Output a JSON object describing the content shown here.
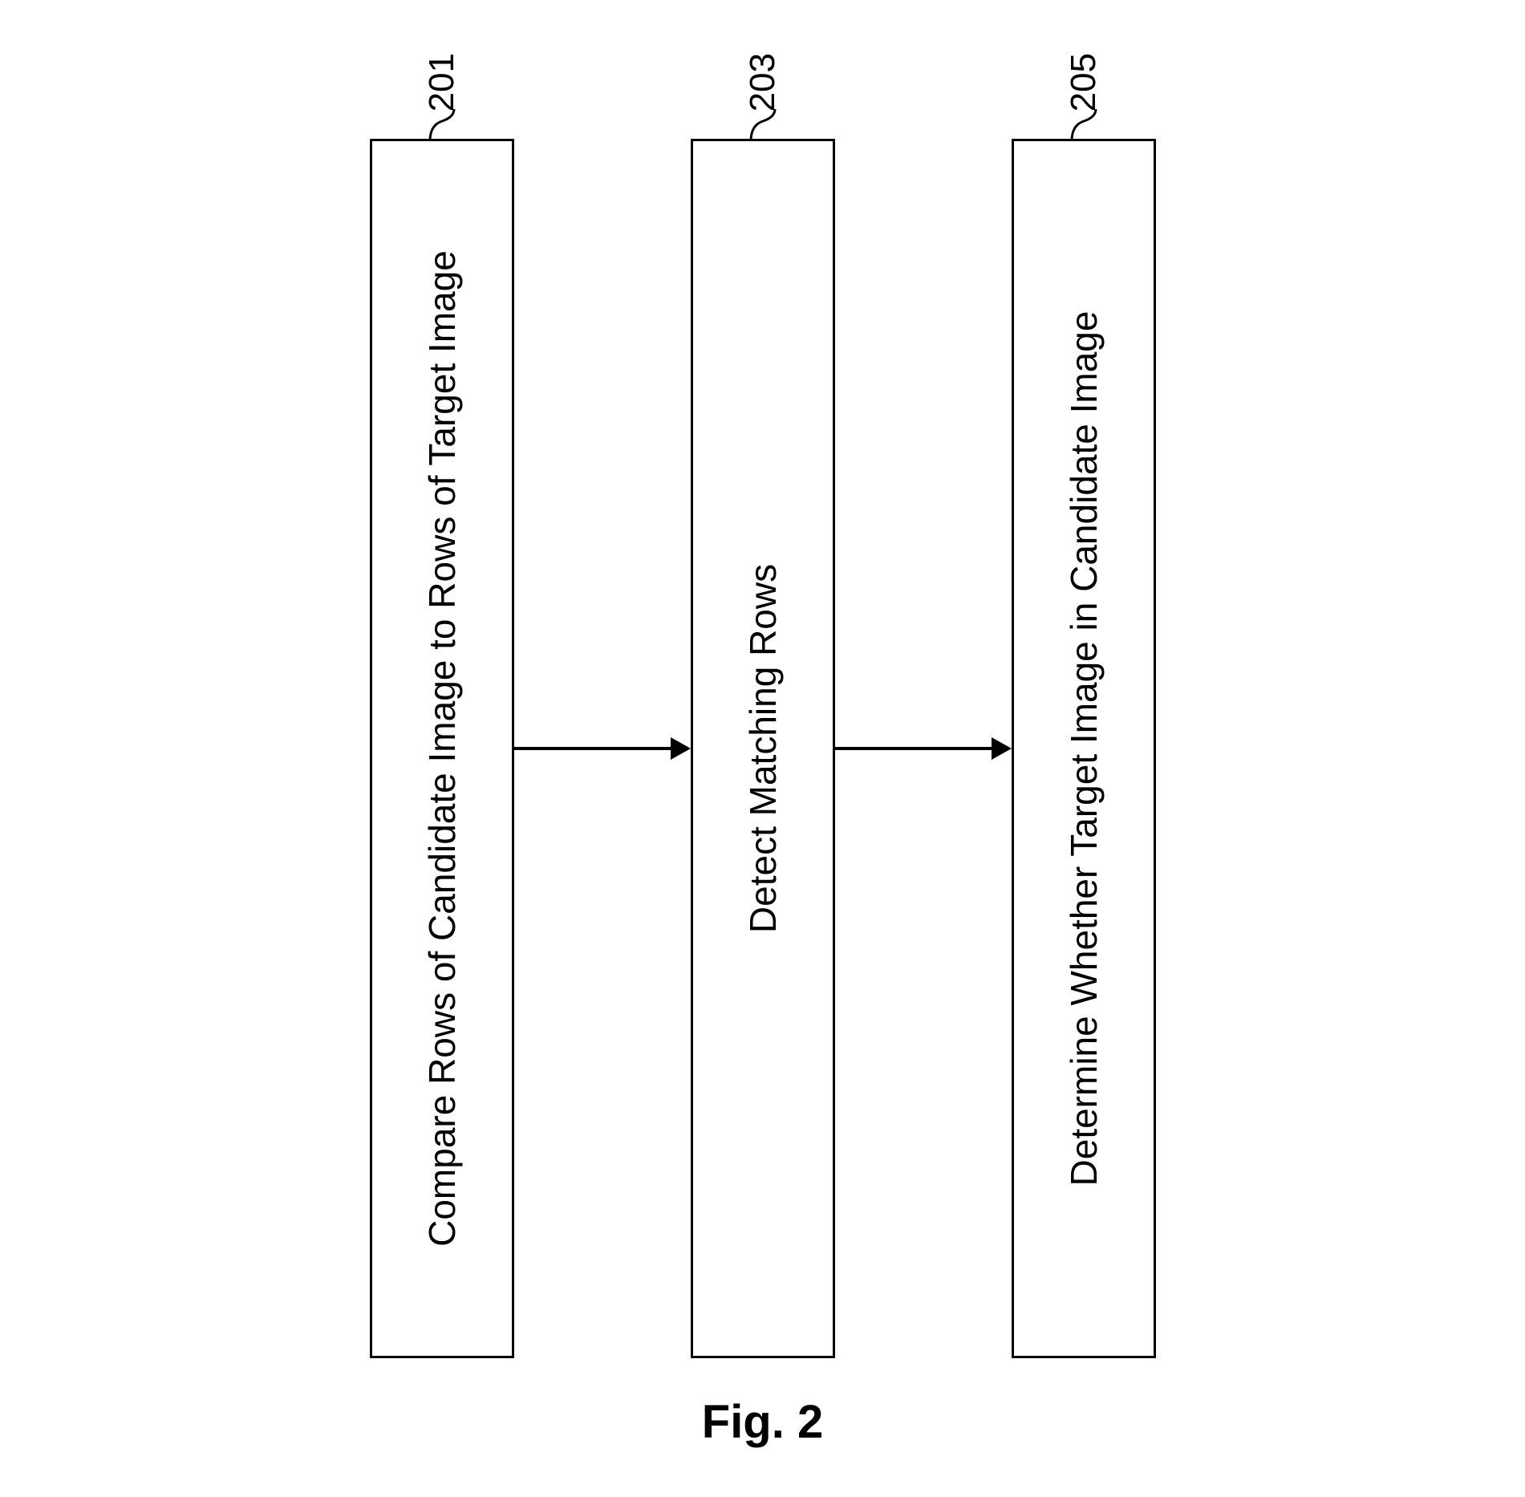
{
  "flowchart": {
    "steps": [
      {
        "text": "Compare Rows of Candidate Image to Rows of Target Image",
        "label": "201"
      },
      {
        "text": "Detect Matching Rows",
        "label": "203"
      },
      {
        "text": "Determine Whether Target Image in Candidate Image",
        "label": "205"
      }
    ]
  },
  "figure_label": "Fig. 2"
}
